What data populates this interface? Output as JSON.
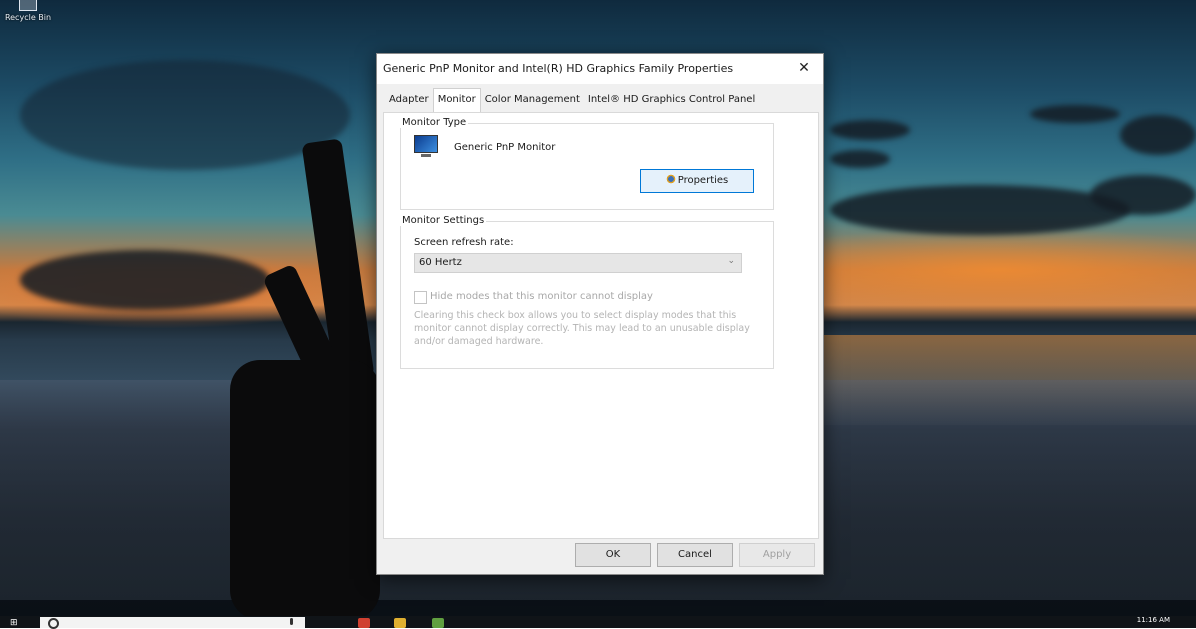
{
  "desktop": {
    "recycle_bin_label": "Recycle Bin"
  },
  "dialog": {
    "title": "Generic PnP Monitor and Intel(R) HD Graphics Family Properties",
    "close_glyph": "✕",
    "tabs": [
      {
        "label": "Adapter"
      },
      {
        "label": "Monitor"
      },
      {
        "label": "Color Management"
      },
      {
        "label": "Intel® HD Graphics Control Panel"
      }
    ],
    "active_tab": "Monitor",
    "monitor_type": {
      "group_label": "Monitor Type",
      "monitor_name": "Generic PnP Monitor",
      "properties_button": "Properties"
    },
    "monitor_settings": {
      "group_label": "Monitor Settings",
      "refresh_rate_label": "Screen refresh rate:",
      "refresh_rate_value": "60 Hertz",
      "hide_modes_label": "Hide modes that this monitor cannot display",
      "help_text": "Clearing this check box allows you to select display modes that this monitor cannot display correctly. This may lead to an unusable display and/or damaged hardware."
    },
    "buttons": {
      "ok": "OK",
      "cancel": "Cancel",
      "apply": "Apply"
    }
  },
  "taskbar": {
    "clock": "11:16 AM"
  },
  "icons": [
    "recycle-bin-icon",
    "close-icon",
    "monitor-icon",
    "properties-gear-icon",
    "dropdown-chevron-icon",
    "windows-start-icon",
    "search-icon",
    "microphone-icon"
  ]
}
